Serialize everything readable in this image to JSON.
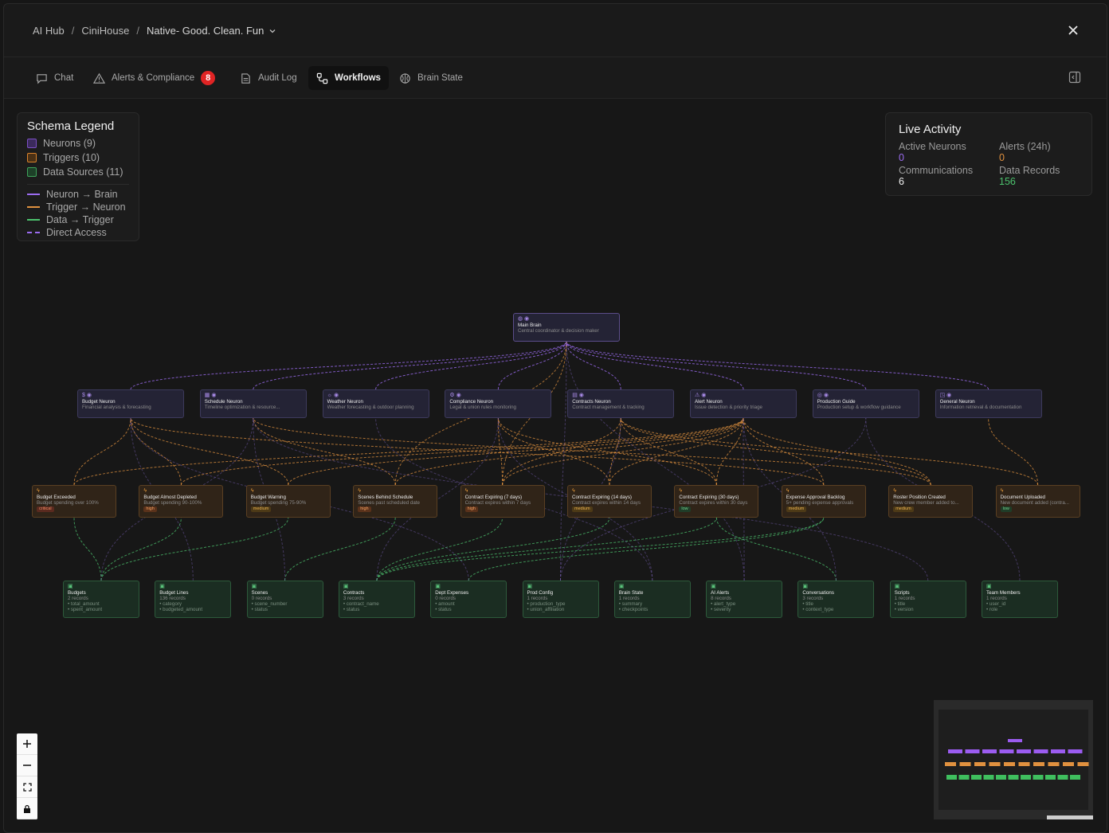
{
  "breadcrumb": {
    "items": [
      "AI Hub",
      "CiniHouse"
    ],
    "current": "Native- Good. Clean. Fun"
  },
  "tabs": [
    {
      "label": "Chat",
      "icon": "chat-icon"
    },
    {
      "label": "Alerts & Compliance",
      "icon": "warning-icon",
      "badge": "8"
    },
    {
      "label": "Audit Log",
      "icon": "document-icon"
    },
    {
      "label": "Workflows",
      "icon": "workflow-icon",
      "active": true
    },
    {
      "label": "Brain State",
      "icon": "brain-icon"
    }
  ],
  "legend": {
    "title": "Schema Legend",
    "node_types": [
      {
        "label": "Neurons (9)",
        "color": "#7c4fc4"
      },
      {
        "label": "Triggers (10)",
        "color": "#d9822b"
      },
      {
        "label": "Data Sources (11)",
        "color": "#3fa35a"
      }
    ],
    "edges": [
      {
        "label": "Neuron → Brain",
        "color": "#9b6cf0",
        "dashed": false
      },
      {
        "label": "Trigger → Neuron",
        "color": "#e0913f",
        "dashed": false
      },
      {
        "label": "Data → Trigger",
        "color": "#4cc26d",
        "dashed": false
      },
      {
        "label": "Direct Access",
        "color": "#9b6cf0",
        "dashed": true
      }
    ]
  },
  "live_activity": {
    "title": "Live Activity",
    "stats": [
      {
        "label": "Active Neurons",
        "value": "0",
        "color": "#9b6cf0"
      },
      {
        "label": "Alerts (24h)",
        "value": "0",
        "color": "#e0913f"
      },
      {
        "label": "Communications",
        "value": "6",
        "color": "#f0f0f0"
      },
      {
        "label": "Data Records",
        "value": "156",
        "color": "#4cc26d"
      }
    ]
  },
  "brain": {
    "title": "Main Brain",
    "subtitle": "Central coordinator & decision maker"
  },
  "neurons": [
    {
      "title": "Budget Neuron",
      "subtitle": "Financial analysis & forecasting",
      "icon": "$"
    },
    {
      "title": "Schedule Neuron",
      "subtitle": "Timeline optimization & resource...",
      "icon": "▦"
    },
    {
      "title": "Weather Neuron",
      "subtitle": "Weather forecasting & outdoor planning",
      "icon": "☼"
    },
    {
      "title": "Compliance Neuron",
      "subtitle": "Legal & union rules monitoring",
      "icon": "⚙"
    },
    {
      "title": "Contracts Neuron",
      "subtitle": "Contract management & tracking",
      "icon": "▤"
    },
    {
      "title": "Alert Neuron",
      "subtitle": "Issue detection & priority triage",
      "icon": "⚠"
    },
    {
      "title": "Production Guide",
      "subtitle": "Production setup & workflow guidance",
      "icon": "◎"
    },
    {
      "title": "General Neuron",
      "subtitle": "Information retrieval & documentation",
      "icon": "◳"
    }
  ],
  "triggers": [
    {
      "title": "Budget Exceeded",
      "subtitle": "Budget spending over 100%",
      "severity": "critical"
    },
    {
      "title": "Budget Almost Depleted",
      "subtitle": "Budget spending 90-100%",
      "severity": "high"
    },
    {
      "title": "Budget Warning",
      "subtitle": "Budget spending 75-90%",
      "severity": "medium"
    },
    {
      "title": "Scenes Behind Schedule",
      "subtitle": "Scenes past scheduled date",
      "severity": "high"
    },
    {
      "title": "Contract Expiring (7 days)",
      "subtitle": "Contract expires within 7 days",
      "severity": "high"
    },
    {
      "title": "Contract Expiring (14 days)",
      "subtitle": "Contract expires within 14 days",
      "severity": "medium"
    },
    {
      "title": "Contract Expiring (30 days)",
      "subtitle": "Contract expires within 30 days",
      "severity": "low"
    },
    {
      "title": "Expense Approval Backlog",
      "subtitle": "5+ pending expense approvals",
      "severity": "medium"
    },
    {
      "title": "Roster Position Created",
      "subtitle": "New crew member added to...",
      "severity": "medium"
    },
    {
      "title": "Document Uploaded",
      "subtitle": "New document added (contra...",
      "severity": "low"
    }
  ],
  "data_sources": [
    {
      "title": "Budgets",
      "records": "2 records",
      "fields": [
        "• total_amount",
        "• spent_amount"
      ]
    },
    {
      "title": "Budget Lines",
      "records": "136 records",
      "fields": [
        "• category",
        "• budgeted_amount"
      ]
    },
    {
      "title": "Scenes",
      "records": "0 records",
      "fields": [
        "• scene_number",
        "• status"
      ]
    },
    {
      "title": "Contracts",
      "records": "3 records",
      "fields": [
        "• contract_name",
        "• status"
      ]
    },
    {
      "title": "Dept Expenses",
      "records": "0 records",
      "fields": [
        "• amount",
        "• status"
      ]
    },
    {
      "title": "Prod Config",
      "records": "1 records",
      "fields": [
        "• production_type",
        "• union_affiliation"
      ]
    },
    {
      "title": "Brain State",
      "records": "1 records",
      "fields": [
        "• summary",
        "• checkpoints"
      ]
    },
    {
      "title": "AI Alerts",
      "records": "8 records",
      "fields": [
        "• alert_type",
        "• severity"
      ]
    },
    {
      "title": "Conversations",
      "records": "3 records",
      "fields": [
        "• title",
        "• context_type"
      ]
    },
    {
      "title": "Scripts",
      "records": "1 records",
      "fields": [
        "• title",
        "• version"
      ]
    },
    {
      "title": "Team Members",
      "records": "1 records",
      "fields": [
        "• user_id",
        "• role"
      ]
    }
  ],
  "colors": {
    "neuron": "#9b6cf0",
    "trigger": "#e0913f",
    "data": "#4cc26d"
  }
}
